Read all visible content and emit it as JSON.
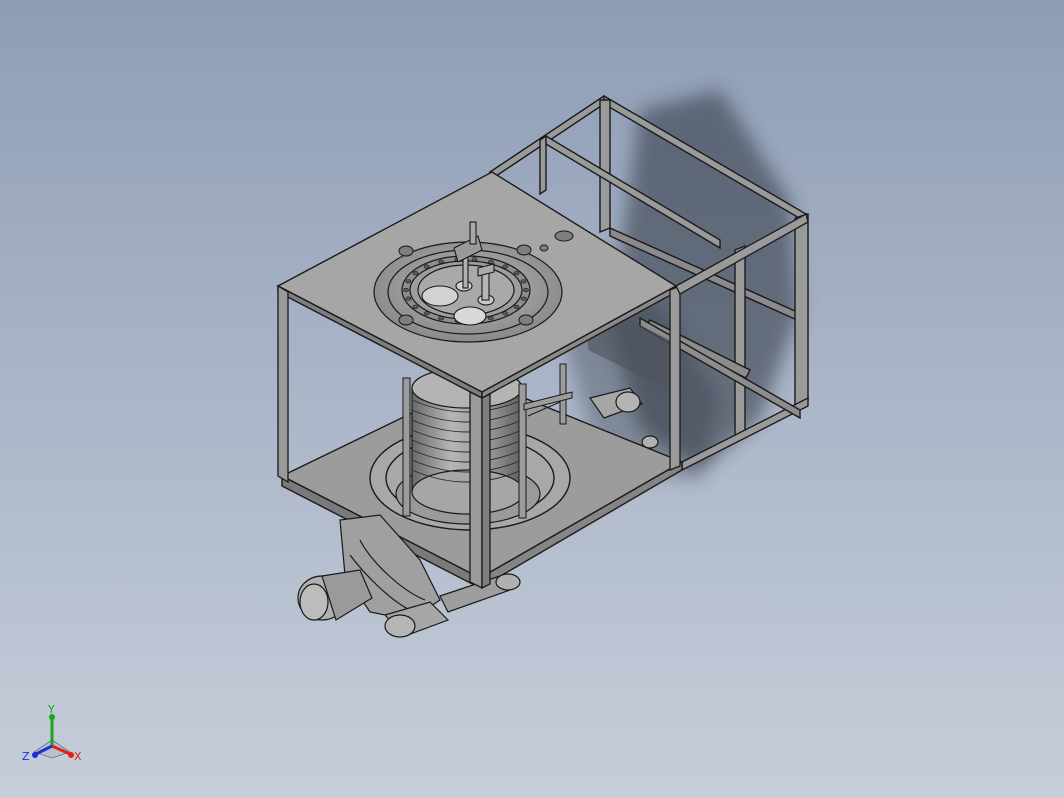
{
  "viewport": {
    "background_top": "#8e9db6",
    "background_bottom": "#c7ceda"
  },
  "model": {
    "line_color": "#1a1a1a",
    "face_light": "#a4a4a4",
    "face_mid": "#8e8e8e",
    "face_dark": "#6e6e6e",
    "shadow": "#2e3540"
  },
  "triad": {
    "x_label": "X",
    "y_label": "Y",
    "z_label": "Z",
    "x_color": "#e0201c",
    "y_color": "#18a818",
    "z_color": "#1c2fd8"
  }
}
